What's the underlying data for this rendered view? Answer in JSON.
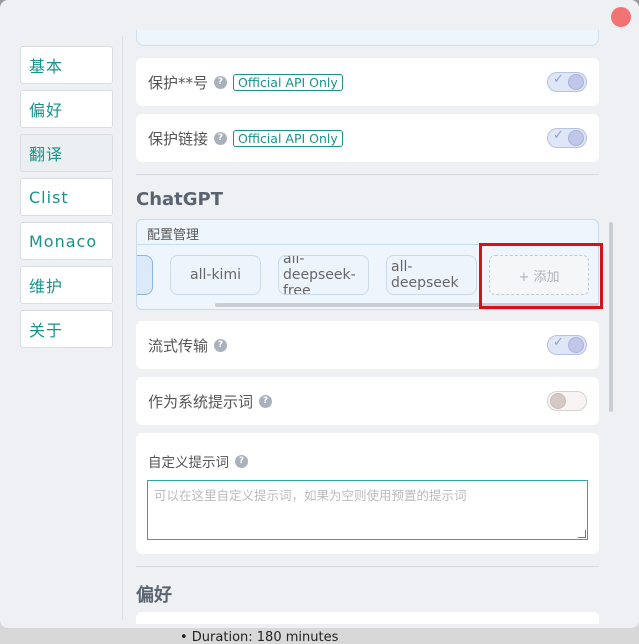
{
  "sidebar": {
    "items": [
      {
        "label": "基本"
      },
      {
        "label": "偏好"
      },
      {
        "label": "翻译"
      },
      {
        "label": "Clist"
      },
      {
        "label": "Monaco"
      },
      {
        "label": "维护"
      },
      {
        "label": "关于"
      }
    ]
  },
  "settings": {
    "protect_number": {
      "label": "保护**号",
      "tag": "Official API Only",
      "enabled": true
    },
    "protect_link": {
      "label": "保护链接",
      "tag": "Official API Only",
      "enabled": true
    }
  },
  "chatgpt": {
    "section_title": "ChatGPT",
    "config_title": "配置管理",
    "models": [
      "all-kimi",
      "all-deepseek-free",
      "all-deepseek"
    ],
    "add_label": "+ 添加",
    "stream": {
      "label": "流式传输",
      "enabled": true
    },
    "as_system_prompt": {
      "label": "作为系统提示词",
      "enabled": false
    },
    "custom_prompt": {
      "label": "自定义提示词",
      "placeholder": "可以在这里自定义提示词，如果为空则使用预置的提示词"
    }
  },
  "preferences": {
    "section_title": "偏好"
  },
  "background_text": "• Duration: 180 minutes",
  "icons": {
    "help": "question-circle-icon",
    "check": "check-icon",
    "close": "close-icon"
  },
  "colors": {
    "accent": "#16948a",
    "close": "#f17373",
    "highlight": "#d3121a"
  }
}
